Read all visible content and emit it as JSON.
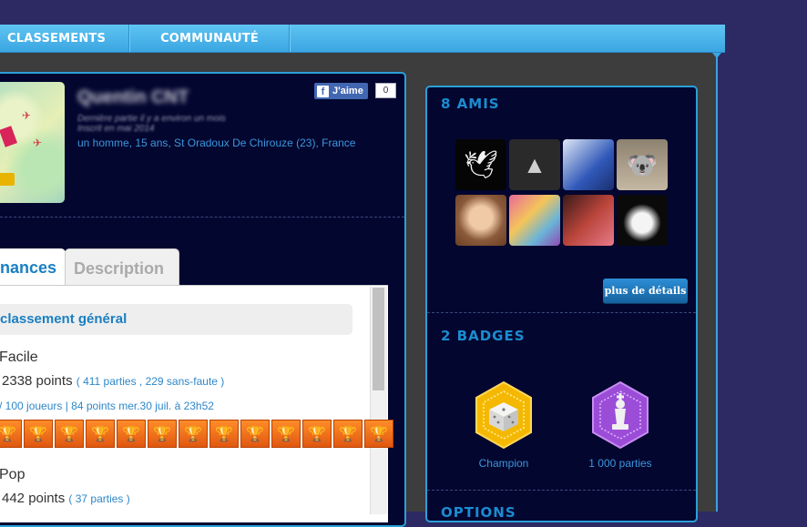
{
  "nav": {
    "items": [
      "CLASSEMENTS",
      "COMMUNAUTÉ"
    ]
  },
  "profile": {
    "username": "Quentin CNT",
    "meta_line1": "Dernière partie il y a environ un mois",
    "meta_line2": "Inscrit en mai 2014",
    "location": "un homme, 15 ans, St Oradoux De Chirouze (23), France",
    "fb_like_label": "J'aime",
    "fb_like_count": "0"
  },
  "tabs": [
    {
      "label": "nances",
      "active": true
    },
    {
      "label": "Description",
      "active": false
    }
  ],
  "performances": {
    "ranking_header": "classement général",
    "modes": [
      {
        "name": "Facile",
        "points": "2338 points",
        "details": "( 411 parties , 229 sans-faute )",
        "rank_line": "/ 100 joueurs | 84 points mer.30 juil. à 23h52",
        "trophy_count": 13
      },
      {
        "name": "Pop",
        "points": "442 points",
        "details": "( 37 parties )"
      }
    ]
  },
  "friends": {
    "title": "8 AMIS",
    "details_button": "plus de détails",
    "avatars": [
      "dove-avatar",
      "assassin-logo-avatar",
      "anime-boy-avatar",
      "koala-avatar",
      "girl-portrait-avatar",
      "anime-group-avatar",
      "friends-photo-avatar",
      "dark-anime-avatar"
    ]
  },
  "badges": {
    "title": "2 BADGES",
    "items": [
      {
        "label": "Champion",
        "icon": "dice-icon",
        "color": "#f5b800"
      },
      {
        "label": "1 000 parties",
        "icon": "chess-king-icon",
        "color": "#9b4dd8"
      }
    ]
  },
  "options": {
    "title": "OPTIONS"
  },
  "colors": {
    "accent": "#3ba6e2",
    "panel": "#03062f",
    "link": "#3b97dd"
  }
}
